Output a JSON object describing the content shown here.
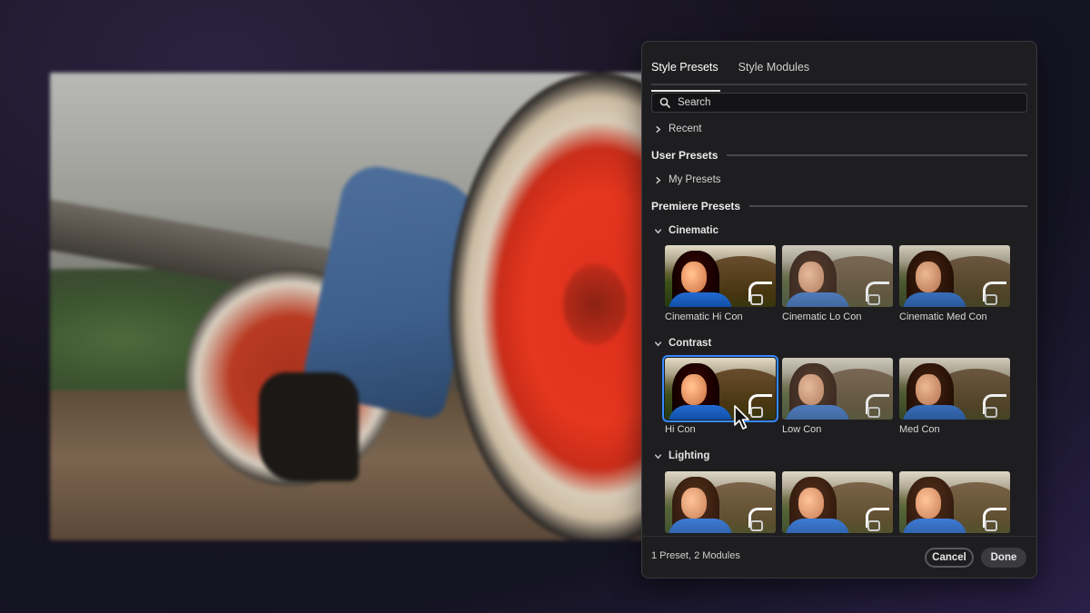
{
  "tabs": [
    {
      "label": "Style Presets",
      "active": true
    },
    {
      "label": "Style Modules",
      "active": false
    }
  ],
  "search": {
    "placeholder": "Search",
    "icon": "search-icon"
  },
  "recent": {
    "label": "Recent",
    "icon": "chevron-right-icon"
  },
  "user_presets": {
    "title": "User Presets",
    "items": [
      {
        "label": "My Presets",
        "icon": "chevron-right-icon"
      }
    ]
  },
  "premiere_presets": {
    "title": "Premiere Presets",
    "groups": [
      {
        "name": "Cinematic",
        "expanded": true,
        "presets": [
          {
            "label": "Cinematic Hi Con"
          },
          {
            "label": "Cinematic Lo Con"
          },
          {
            "label": "Cinematic Med Con"
          }
        ]
      },
      {
        "name": "Contrast",
        "expanded": true,
        "presets": [
          {
            "label": "Hi Con",
            "selected": true
          },
          {
            "label": "Low Con"
          },
          {
            "label": "Med Con"
          }
        ]
      },
      {
        "name": "Lighting",
        "expanded": true,
        "presets": [
          {
            "label": ""
          },
          {
            "label": ""
          },
          {
            "label": ""
          }
        ]
      }
    ]
  },
  "footer": {
    "status": "1 Preset, 2 Modules",
    "cancel_label": "Cancel",
    "done_label": "Done"
  },
  "colors": {
    "panel_bg": "#1e1e20",
    "selection_accent": "#4d86e6",
    "frame_red_wheel": "#e0301d"
  }
}
